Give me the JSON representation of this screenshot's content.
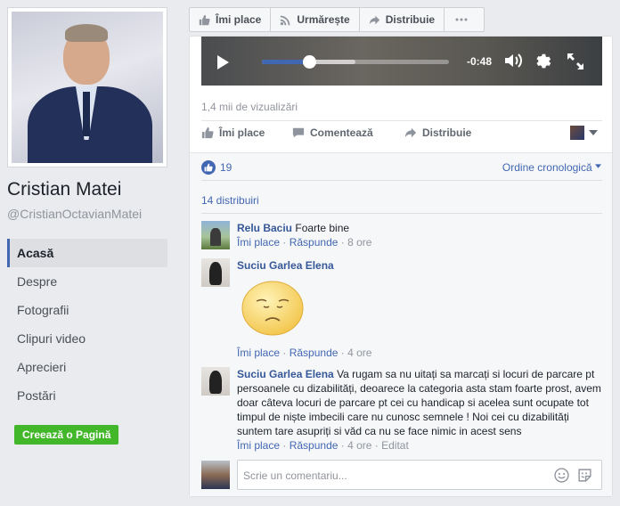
{
  "page": {
    "name": "Cristian Matei",
    "handle": "@CristianOctavianMatei"
  },
  "nav": {
    "items": [
      {
        "label": "Acasă"
      },
      {
        "label": "Despre"
      },
      {
        "label": "Fotografii"
      },
      {
        "label": "Clipuri video"
      },
      {
        "label": "Aprecieri"
      },
      {
        "label": "Postări"
      }
    ],
    "create_page": "Creează o Pagină"
  },
  "topbar": {
    "like": "Îmi place",
    "follow": "Urmărește",
    "share": "Distribuie"
  },
  "video": {
    "time_left": "-0:48",
    "progress": 0.25,
    "buffered": 0.5
  },
  "post": {
    "views": "1,4 mii de vizualizări",
    "actions": {
      "like": "Îmi place",
      "comment": "Comentează",
      "share": "Distribuie"
    },
    "likes_count": "19",
    "order": "Ordine cronologică",
    "shares": "14 distribuiri"
  },
  "comments": [
    {
      "author": "Relu Baciu",
      "text": "Foarte bine",
      "like": "Îmi place",
      "reply": "Răspunde",
      "time": "8 ore"
    },
    {
      "author": "Suciu Garlea Elena",
      "text": "",
      "like": "Îmi place",
      "reply": "Răspunde",
      "time": "4 ore"
    },
    {
      "author": "Suciu Garlea Elena",
      "text": "Va rugam sa nu uitați sa marcați si locuri de parcare pt persoanele cu dizabilități, deoarece la categoria asta stam foarte prost, avem doar câteva locuri de parcare pt cei cu handicap si acelea sunt ocupate tot timpul de niște imbecili care nu cunosc semnele ! Noi cei cu dizabilități suntem tare asupriți si văd ca nu se face nimic in acest sens",
      "like": "Îmi place",
      "reply": "Răspunde",
      "time": "4 ore",
      "edited": "Editat"
    }
  ],
  "composer": {
    "placeholder": "Scrie un comentariu..."
  },
  "colors": {
    "brand": "#4267b2",
    "link": "#365899",
    "create_button": "#42b72a"
  }
}
